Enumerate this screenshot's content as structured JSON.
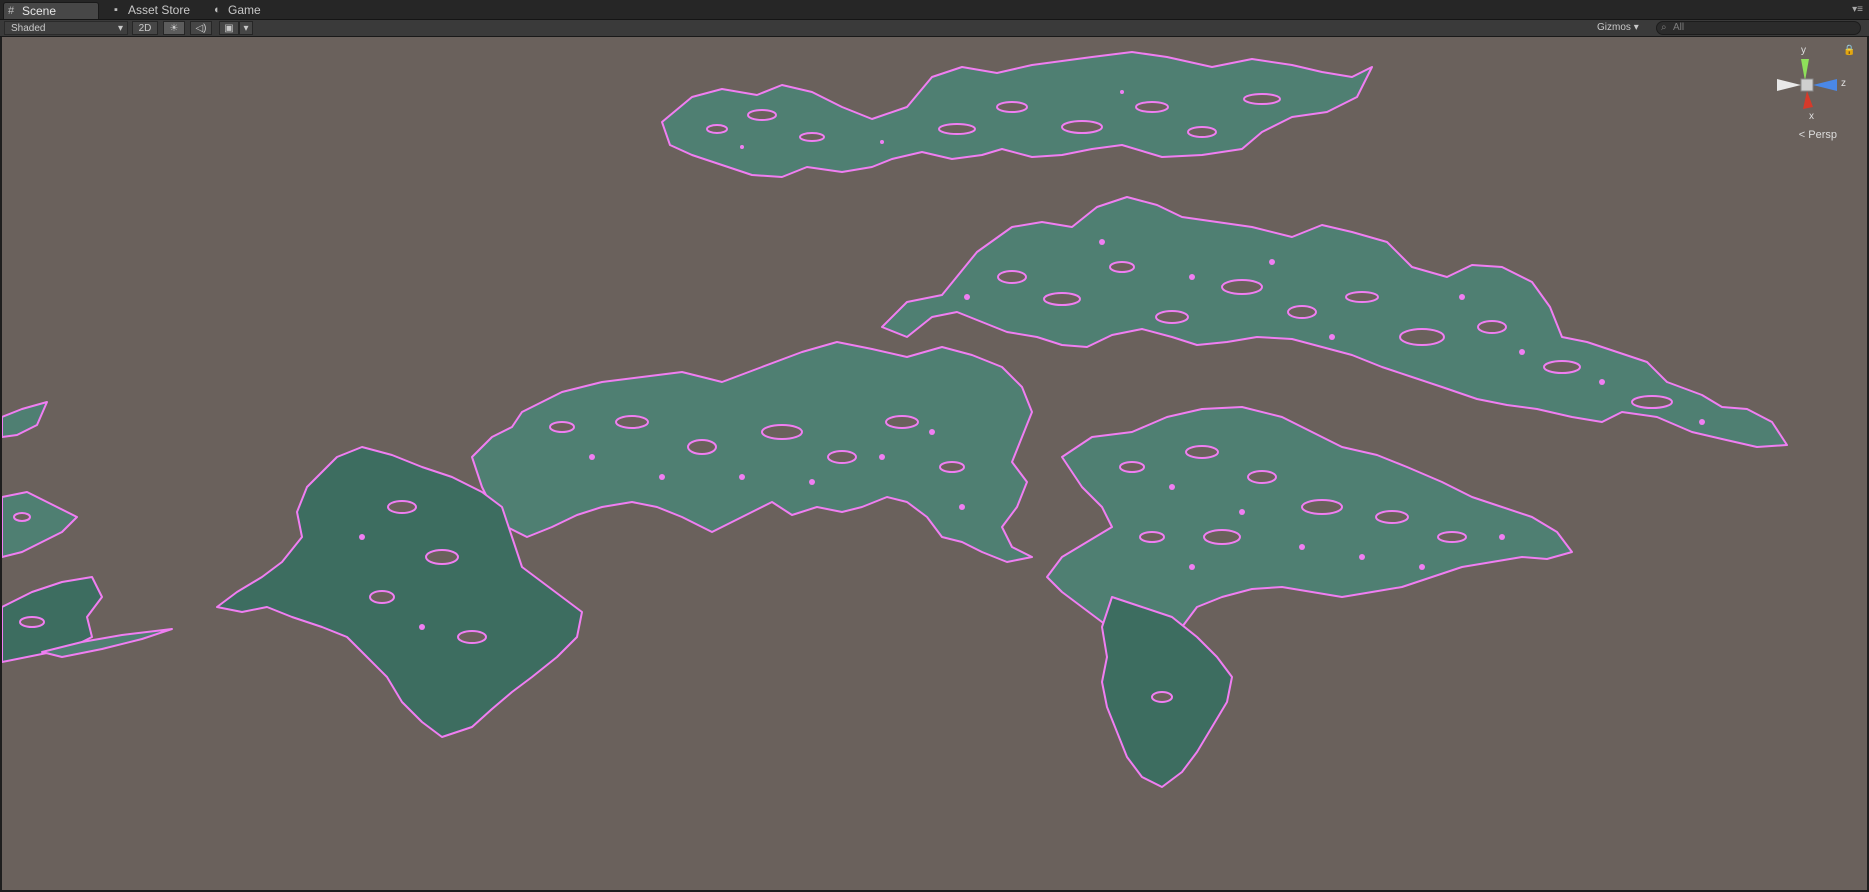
{
  "tabs": [
    {
      "label": "Scene",
      "icon": "#",
      "active": true
    },
    {
      "label": "Asset Store",
      "icon": "▪",
      "active": false
    },
    {
      "label": "Game",
      "icon": "◐",
      "active": false
    }
  ],
  "tab_menu_icon": "▾≡",
  "toolbar": {
    "shading": "Shaded",
    "mode_2d": "2D",
    "lighting_icon": "☀",
    "audio_icon": "◁)",
    "fx_icon": "▣",
    "fx_drop": "▾",
    "gizmos": "Gizmos",
    "search_placeholder": "All",
    "search_icon": "⌕"
  },
  "view": {
    "axis_y": "y",
    "axis_z": "z",
    "axis_x": "x",
    "projection": "Persp",
    "lock_icon": "🔒"
  },
  "colors": {
    "bg": "#6a615c",
    "outline": "#f07ef2",
    "leaf": "#4f7f72"
  }
}
